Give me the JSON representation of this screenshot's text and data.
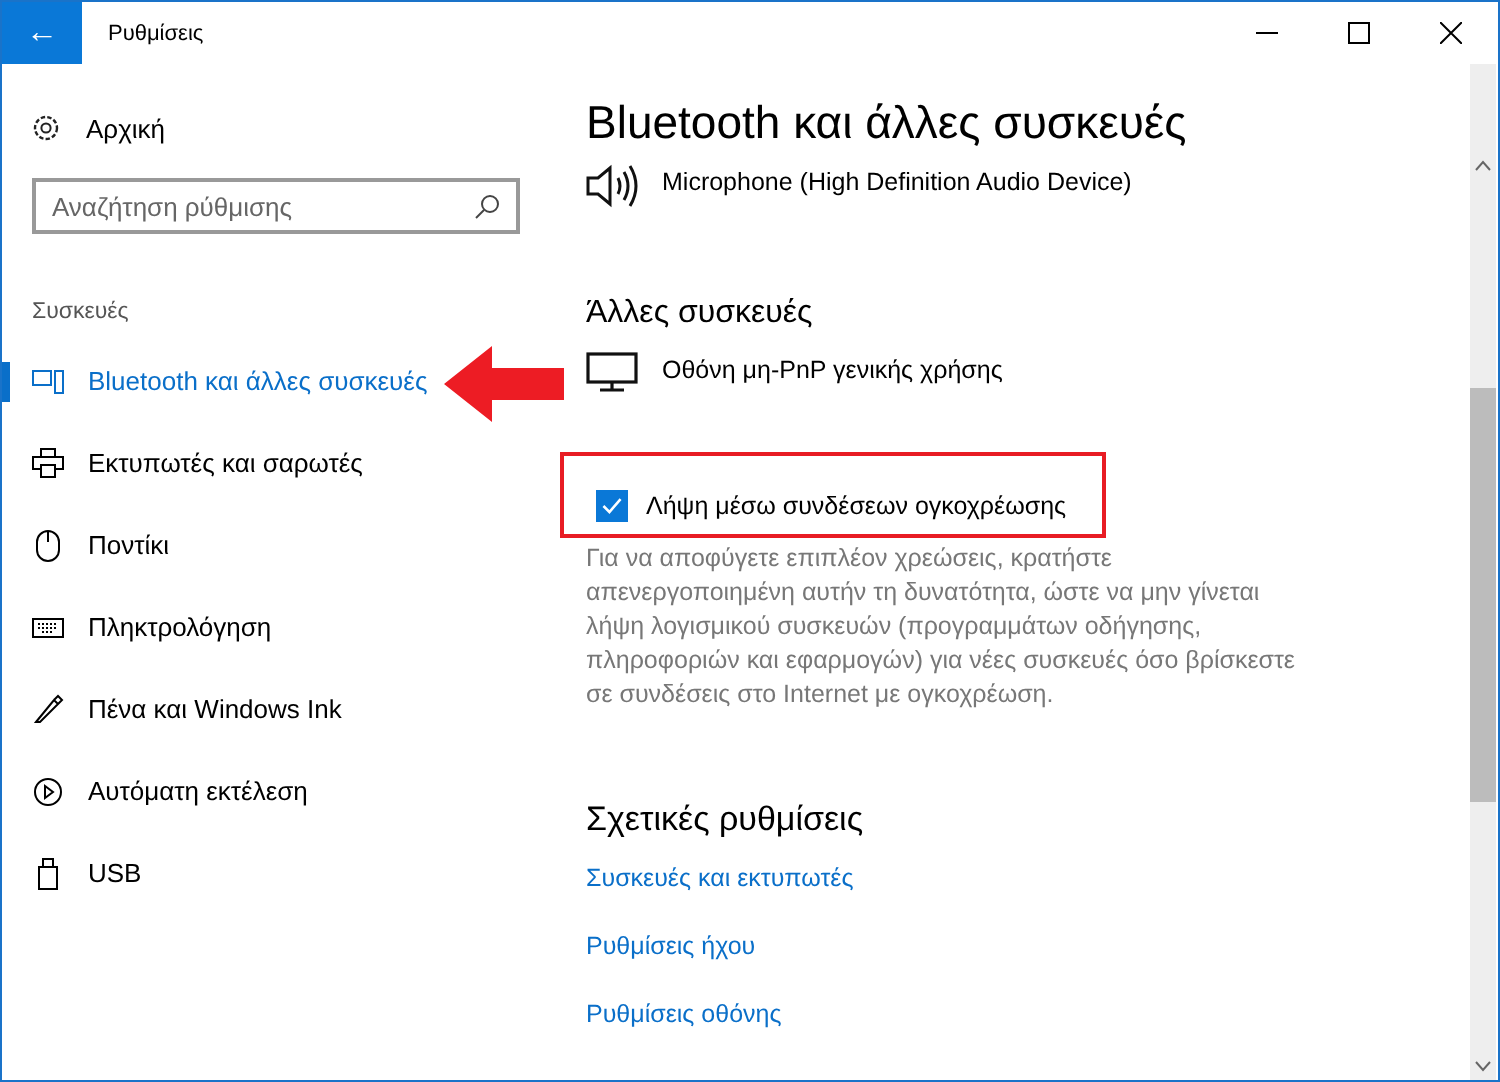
{
  "window": {
    "title": "Ρυθμίσεις",
    "back": "←"
  },
  "sidebar": {
    "home": "Αρχική",
    "search": {
      "placeholder": "Αναζήτηση ρύθμισης"
    },
    "section": "Συσκευές",
    "items": [
      {
        "label": "Bluetooth και άλλες συσκευές",
        "selected": true
      },
      {
        "label": "Εκτυπωτές και σαρωτές",
        "selected": false
      },
      {
        "label": "Ποντίκι",
        "selected": false
      },
      {
        "label": "Πληκτρολόγηση",
        "selected": false
      },
      {
        "label": "Πένα και Windows Ink",
        "selected": false
      },
      {
        "label": "Αυτόματη εκτέλεση",
        "selected": false
      },
      {
        "label": "USB",
        "selected": false
      }
    ]
  },
  "content": {
    "title": "Bluetooth και άλλες συσκευές",
    "audio_device": "Microphone (High Definition Audio Device)",
    "other_heading": "Άλλες συσκευές",
    "other_device": "Οθόνη μη-PnP γενικής χρήσης",
    "metered": {
      "label": "Λήψη μέσω συνδέσεων ογκοχρέωσης",
      "checked": true
    },
    "description": "Για να αποφύγετε επιπλέον χρεώσεις, κρατήστε απενεργοποιημένη αυτήν τη δυνατότητα, ώστε να μην γίνεται λήψη λογισμικού συσκευών (προγραμμάτων οδήγησης, πληροφοριών και εφαρμογών) για νέες συσκευές όσο βρίσκεστε σε συνδέσεις στο Internet με ογκοχρέωση.",
    "related_heading": "Σχετικές ρυθμίσεις",
    "related_links": [
      "Συσκευές και εκτυπωτές",
      "Ρυθμίσεις ήχου",
      "Ρυθμίσεις οθόνης"
    ]
  }
}
